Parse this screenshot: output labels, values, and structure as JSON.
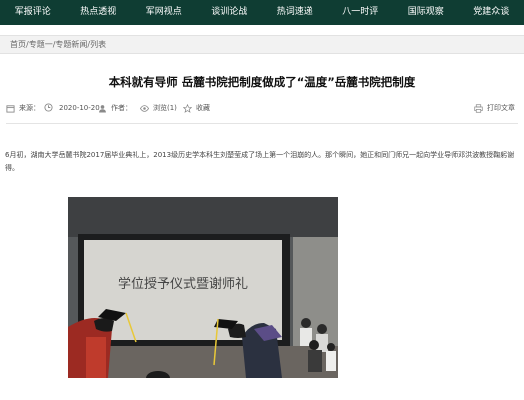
{
  "nav": {
    "items": [
      "军报评论",
      "热点透视",
      "军网视点",
      "谈训论战",
      "热词速递",
      "八一时评",
      "国际观察",
      "党建众谈"
    ]
  },
  "breadcrumb": "首页/专题一/专题新闻/列表",
  "article": {
    "title": "本科就有导师 岳麓书院把制度做成了“温度”岳麓书院把制度",
    "meta": {
      "source_label": "来源：",
      "date": "2020-10-20",
      "author_label": "作者：",
      "views": "浏览(1)",
      "favorite": "收藏",
      "print": "打印文章"
    },
    "paragraph": "6月初，湖南大学岳麓书院2017届毕业典礼上，2013级历史学本科生刘楚莹成了场上第一个泪崩的人。那个瞬间，她正和同门师兄一起向学业导师邓洪波教授鞠躬谢得。",
    "photo_caption_text": "学位授予仪式暨谢师礼"
  },
  "colors": {
    "nav_bg": "#0f3d33",
    "nav_text": "#ffffff",
    "crumb_bg": "#f2f2f2"
  },
  "icons": [
    "calendar-icon",
    "user-icon",
    "eye-icon",
    "star-icon",
    "printer-icon"
  ]
}
